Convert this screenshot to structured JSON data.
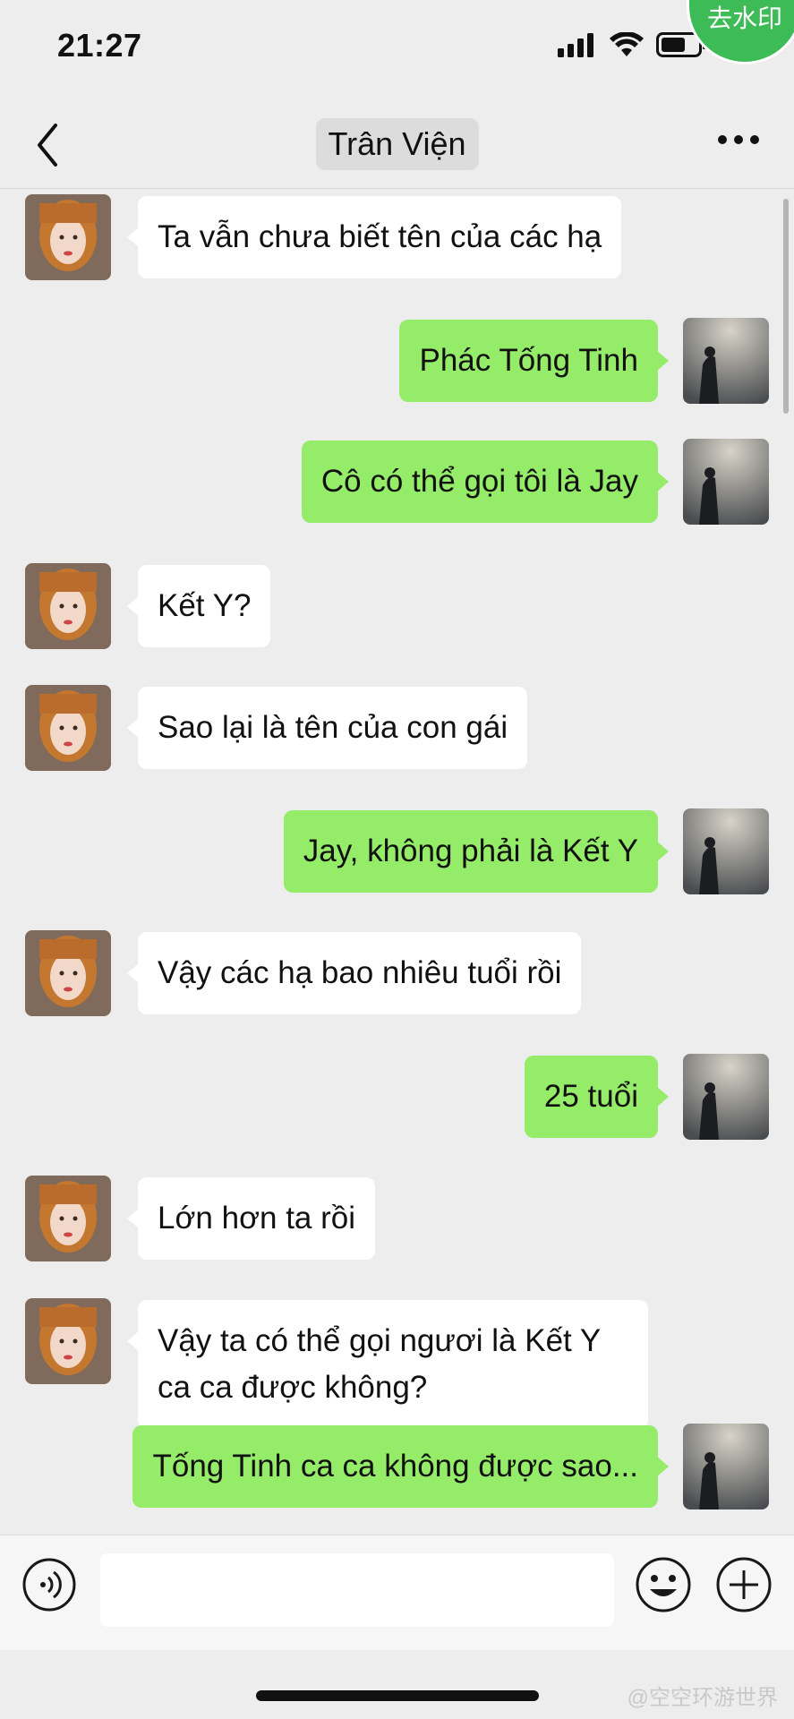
{
  "status_bar": {
    "time": "21:27",
    "watermark_button": "去水印"
  },
  "header": {
    "title": "Trân Viện"
  },
  "messages": [
    {
      "side": "in",
      "text": "Ta vẫn chưa biết tên của các hạ"
    },
    {
      "side": "out",
      "text": "Phác Tống Tinh"
    },
    {
      "side": "out",
      "text": "Cô có thể gọi tôi là Jay"
    },
    {
      "side": "in",
      "text": "Kết Y?"
    },
    {
      "side": "in",
      "text": "Sao lại là tên của con gái"
    },
    {
      "side": "out",
      "text": "Jay, không phải là Kết Y"
    },
    {
      "side": "in",
      "text": "Vậy các hạ bao nhiêu tuổi rồi"
    },
    {
      "side": "out",
      "text": "25 tuổi"
    },
    {
      "side": "in",
      "text": "Lớn hơn ta rồi"
    },
    {
      "side": "in",
      "text": "Vậy ta có thể gọi ngươi là Kết Y ca ca được không?"
    },
    {
      "side": "out",
      "text": "Tống Tinh ca ca không được sao..."
    }
  ],
  "footer": {
    "credit": "@空空环游世界"
  },
  "colors": {
    "background": "#ededed",
    "outgoing_bubble": "#95ec69",
    "incoming_bubble": "#ffffff",
    "watermark_button": "#3dbb57"
  },
  "icons": [
    "signal-icon",
    "wifi-icon",
    "battery-icon",
    "back-chevron-icon",
    "more-dots-icon",
    "voice-icon",
    "emoji-icon",
    "plus-icon"
  ]
}
